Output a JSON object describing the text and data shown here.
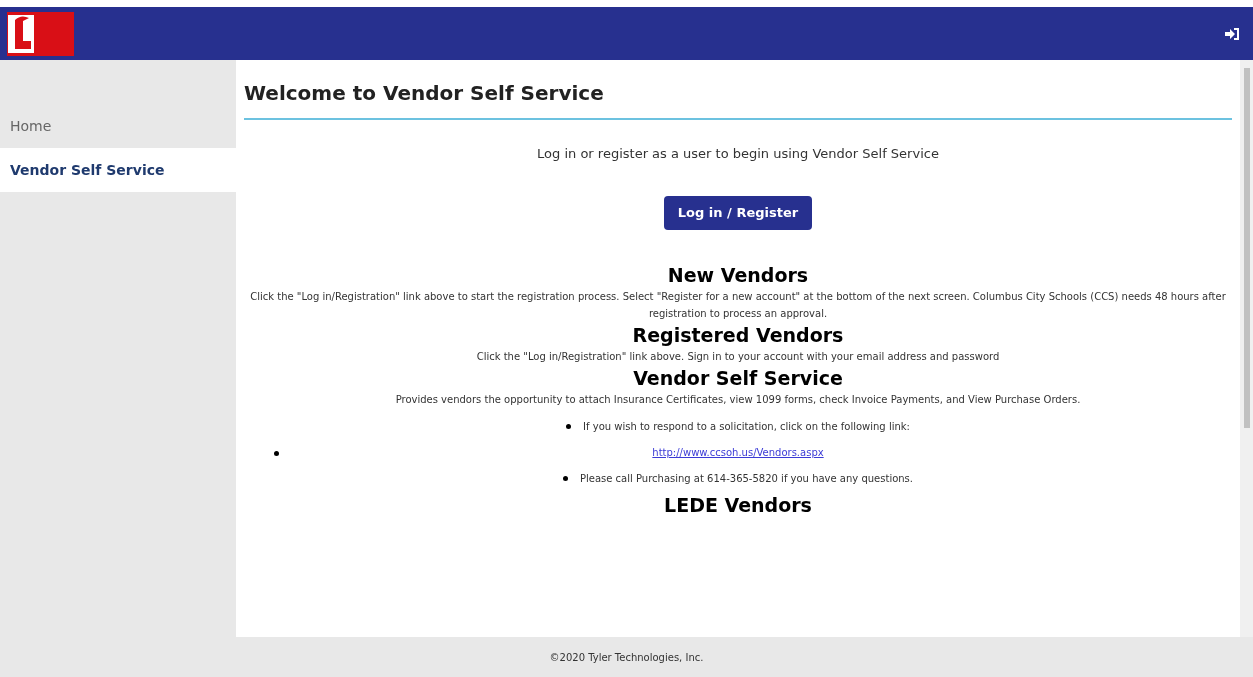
{
  "sidebar": {
    "items": [
      {
        "label": "Home",
        "selected": false
      },
      {
        "label": "Vendor Self Service",
        "selected": true
      }
    ]
  },
  "page_title": "Welcome to Vendor Self Service",
  "intro": "Log in or register as a user to begin using Vendor Self Service",
  "login_button": "Log in / Register",
  "sections": [
    {
      "heading": "New Vendors",
      "text": "Click the \"Log in/Registration\" link above to start the registration process. Select \"Register for a new account\" at the bottom of the next screen. Columbus City Schools (CCS) needs 48 hours after registration to process an approval."
    },
    {
      "heading": "Registered Vendors",
      "text": "Click the \"Log in/Registration\" link above. Sign in to your account with your email address and password"
    },
    {
      "heading": "Vendor Self Service",
      "text": "Provides vendors the opportunity to attach Insurance Certificates, view 1099 forms, check Invoice Payments, and View Purchase Orders.",
      "bullets": [
        {
          "kind": "text",
          "text": "If you wish to respond to a solicitation, click on the following link:"
        },
        {
          "kind": "link",
          "text": "http://www.ccsoh.us/Vendors.aspx"
        },
        {
          "kind": "text",
          "text": "Please call Purchasing at 614-365-5820 if you have any questions."
        }
      ]
    },
    {
      "heading": "LEDE Vendors"
    }
  ],
  "footer": "©2020 Tyler Technologies, Inc."
}
